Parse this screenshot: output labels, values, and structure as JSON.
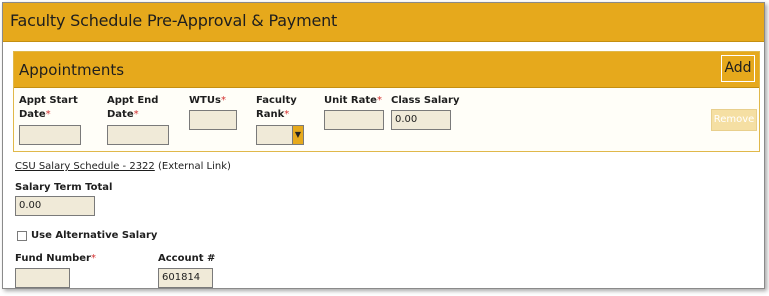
{
  "form": {
    "title": "Faculty Schedule Pre-Approval & Payment"
  },
  "appointments": {
    "title": "Appointments",
    "add_label": "Add",
    "remove_label": "Remove",
    "required_marker": "*",
    "fields": {
      "appt_start_line1": "Appt Start",
      "appt_start_line2": "Date",
      "appt_end_line1": "Appt End",
      "appt_end_line2": "Date",
      "wtus": "WTUs",
      "faculty_rank_line1": "Faculty",
      "faculty_rank_line2": "Rank",
      "unit_rate": "Unit Rate",
      "class_salary": "Class Salary"
    },
    "values": {
      "appt_start": "",
      "appt_end": "",
      "wtus": "",
      "faculty_rank": "",
      "unit_rate": "",
      "class_salary": "0.00"
    }
  },
  "salary_schedule_link": {
    "link_text": "CSU Salary Schedule - 2322",
    "suffix": " (External Link)"
  },
  "salary_term_total": {
    "label": "Salary Term Total",
    "value": "0.00"
  },
  "use_alternative_salary": {
    "label": "Use Alternative Salary",
    "checked": false
  },
  "fund_number": {
    "label": "Fund Number",
    "value": ""
  },
  "account": {
    "label": "Account #",
    "value": "601814"
  }
}
